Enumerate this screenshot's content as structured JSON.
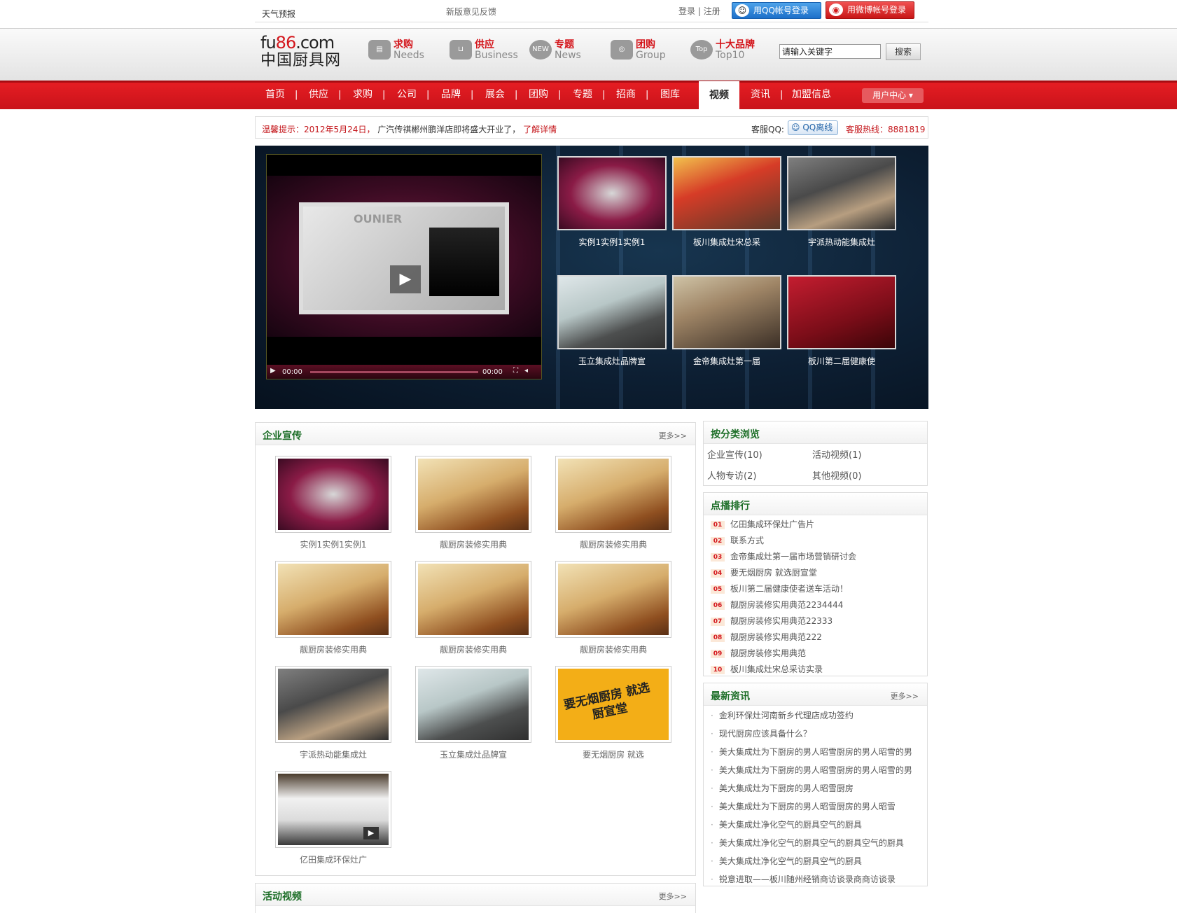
{
  "topbar": {
    "weather": "天气预报",
    "feedback": "新版意见反馈",
    "login": "登录",
    "register": "注册",
    "qq_login": "用QQ帐号登录",
    "weibo_login": "用微博帐号登录"
  },
  "logo": {
    "domain_prefix": "fu",
    "domain_highlight": "86",
    "domain_suffix": ".com",
    "cn_name": "中国厨具网"
  },
  "header_links": [
    {
      "cn": "求购",
      "en": "Needs",
      "icon": "clipboard-icon"
    },
    {
      "cn": "供应",
      "en": "Business",
      "icon": "basket-icon"
    },
    {
      "cn": "专题",
      "en": "News",
      "icon": "new-badge-icon"
    },
    {
      "cn": "团购",
      "en": "Group",
      "icon": "camera-icon"
    },
    {
      "cn": "十大品牌",
      "en": "Top10",
      "icon": "top-badge-icon"
    }
  ],
  "search": {
    "value": "请输入关键字",
    "button": "搜索"
  },
  "nav": {
    "items": [
      "首页",
      "供应",
      "求购",
      "公司",
      "品牌",
      "展会",
      "团购",
      "专题",
      "招商",
      "图库",
      "视频",
      "资讯",
      "加盟信息"
    ],
    "active": "视频",
    "user_center": "用户中心"
  },
  "notice": {
    "label": "温馨提示：2012年5月24日，",
    "message": "广汽传祺郴州鹏洋店即将盛大开业了，",
    "link": "了解详情",
    "kf_label": "客服QQ:",
    "qq_status": "QQ离线",
    "hotline": "客服热线：8881819"
  },
  "stage": {
    "player": {
      "brand": "OUNIER",
      "time_current": "00:00",
      "time_total": "00:00"
    },
    "thumbs": [
      {
        "caption": "实例1实例1实例1",
        "theme": "showroom"
      },
      {
        "caption": "板川集成灶宋总采",
        "theme": "board"
      },
      {
        "caption": "宇派热动能集成灶",
        "theme": "person"
      },
      {
        "caption": "玉立集成灶品牌宣",
        "theme": "stove"
      },
      {
        "caption": "金帝集成灶第一届",
        "theme": "meeting"
      },
      {
        "caption": "板川第二届健康使",
        "theme": "red"
      }
    ]
  },
  "corporate": {
    "title": "企业宣传",
    "more": "更多>>",
    "videos": [
      {
        "caption": "实例1实例1实例1",
        "theme": "showroom"
      },
      {
        "caption": "靓厨房装修实用典",
        "theme": "kitchen"
      },
      {
        "caption": "靓厨房装修实用典",
        "theme": "kitchen"
      },
      {
        "caption": "靓厨房装修实用典",
        "theme": "kitchen"
      },
      {
        "caption": "靓厨房装修实用典",
        "theme": "kitchen"
      },
      {
        "caption": "靓厨房装修实用典",
        "theme": "kitchen"
      },
      {
        "caption": "宇派热动能集成灶",
        "theme": "person"
      },
      {
        "caption": "玉立集成灶品牌宣",
        "theme": "stove"
      },
      {
        "caption": "要无烟厨房 就选",
        "theme": "yellow",
        "overlay": "要无烟厨房 就选厨宣堂"
      },
      {
        "caption": "亿田集成环保灶广",
        "theme": "cabinet"
      }
    ]
  },
  "activity": {
    "title": "活动视频",
    "more": "更多>>"
  },
  "categories": {
    "title": "按分类浏览",
    "items": [
      "企业宣传(10)",
      "活动视频(1)",
      "人物专访(2)",
      "其他视频(0)"
    ]
  },
  "ranking": {
    "title": "点播排行",
    "items": [
      {
        "num": "01",
        "text": "亿田集成环保灶广告片"
      },
      {
        "num": "02",
        "text": "联系方式"
      },
      {
        "num": "03",
        "text": "金帝集成灶第一届市场营销研讨会"
      },
      {
        "num": "04",
        "text": "要无烟厨房 就选厨宣堂"
      },
      {
        "num": "05",
        "text": "板川第二届健康使者送车活动！"
      },
      {
        "num": "06",
        "text": "靓厨房装修实用典范2234444"
      },
      {
        "num": "07",
        "text": "靓厨房装修实用典范22333"
      },
      {
        "num": "08",
        "text": "靓厨房装修实用典范222"
      },
      {
        "num": "09",
        "text": "靓厨房装修实用典范"
      },
      {
        "num": "10",
        "text": "板川集成灶宋总采访实录"
      }
    ]
  },
  "news": {
    "title": "最新资讯",
    "more": "更多>>",
    "items": [
      "金利环保灶河南新乡代理店成功签约",
      "现代厨房应该具备什么？",
      "美大集成灶为下厨房的男人昭雪厨房的男人昭雪的男",
      "美大集成灶为下厨房的男人昭雪厨房的男人昭雪的男",
      "美大集成灶为下厨房的男人昭雪厨房",
      "美大集成灶为下厨房的男人昭雪厨房的男人昭雪",
      "美大集成灶净化空气的厨具空气的厨具",
      "美大集成灶净化空气的厨具空气的厨具空气的厨具",
      "美大集成灶净化空气的厨具空气的厨具",
      "锐意进取——板川随州经销商访谈录商商访谈录"
    ]
  }
}
